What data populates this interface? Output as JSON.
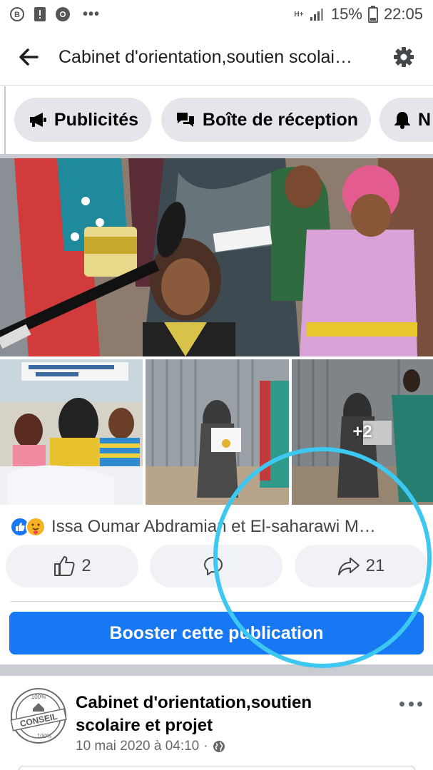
{
  "status_bar": {
    "battery_percent": "15%",
    "time": "22:05",
    "network": "H+",
    "icons": [
      "b-badge-icon",
      "alert-icon",
      "chrome-icon",
      "more-dots-icon",
      "signal-icon",
      "battery-icon"
    ]
  },
  "header": {
    "title": "Cabinet d'orientation,soutien scolai…"
  },
  "chips": [
    {
      "label": "Publicités",
      "icon": "megaphone-icon"
    },
    {
      "label": "Boîte de réception",
      "icon": "chat-bubbles-icon"
    },
    {
      "label": "N",
      "icon": "bell-icon"
    }
  ],
  "post": {
    "more_photos": "+2",
    "reaction_names": "Issa Oumar Abdramian et El-saharawi M…",
    "like_count": "2",
    "share_count": "21",
    "boost_label": "Booster cette publication"
  },
  "post2": {
    "page_name": "Cabinet d'orientation,soutien scolaire et projet",
    "timestamp": "10 mai 2020 à 04:10",
    "logo_text_top": "100%",
    "logo_text_mid": "CONSEIL",
    "logo_text_bottom": "100%"
  },
  "colors": {
    "brand_blue": "#1877f2",
    "chip_bg": "#e4e6eb",
    "annotation_circle": "#3cc8f0"
  }
}
